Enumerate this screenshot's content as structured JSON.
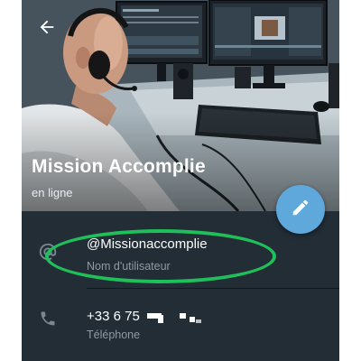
{
  "profile": {
    "name": "Mission Accomplie",
    "status": "en ligne"
  },
  "username_row": {
    "value": "@Missionaccomplie",
    "label": "Nom d'utilisateur"
  },
  "phone_row": {
    "value": "+33 6 75",
    "label": "Téléphone"
  },
  "colors": {
    "background": "#222d36",
    "fab": "#5fa8dc",
    "annotation": "#1fc05a",
    "secondary_text": "#8e9aa4"
  },
  "icons": {
    "back": "arrow-left-icon",
    "edit": "pencil-icon",
    "username": "at-sign-icon",
    "phone": "phone-icon"
  }
}
